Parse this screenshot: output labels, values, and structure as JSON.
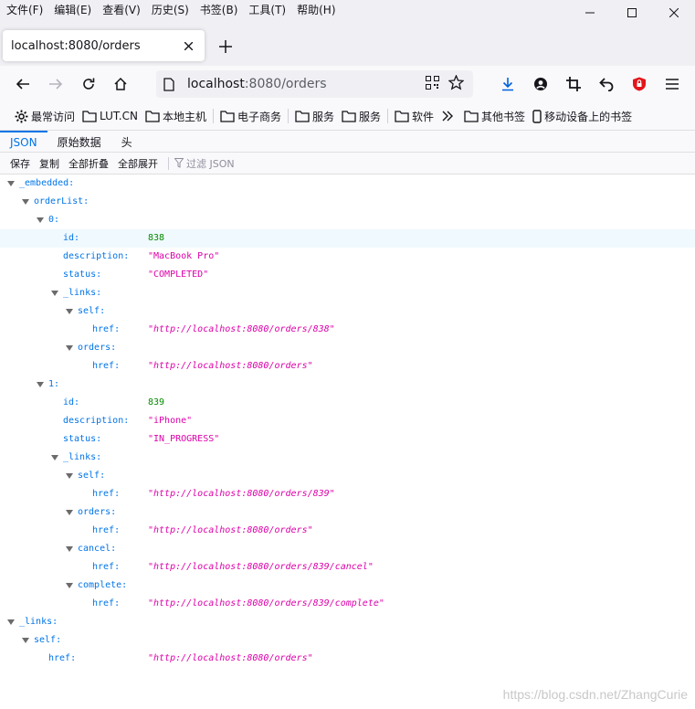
{
  "menu": [
    "文件(F)",
    "编辑(E)",
    "查看(V)",
    "历史(S)",
    "书签(B)",
    "工具(T)",
    "帮助(H)"
  ],
  "tab": {
    "title": "localhost:8080/orders"
  },
  "url": {
    "host": "localhost",
    "path": ":8080/orders"
  },
  "bookmarks": [
    {
      "label": "最常访问",
      "icon": "gear-icon"
    },
    {
      "label": "LUT.CN",
      "icon": "folder-icon"
    },
    {
      "label": "本地主机",
      "icon": "folder-icon"
    },
    {
      "label": "电子商务",
      "icon": "folder-icon"
    },
    {
      "label": "服务",
      "icon": "folder-icon"
    },
    {
      "label": "服务",
      "icon": "folder-icon"
    },
    {
      "label": "软件",
      "icon": "folder-icon"
    },
    {
      "label": "其他书签",
      "icon": "folder-icon"
    },
    {
      "label": "移动设备上的书签",
      "icon": "mobile-icon"
    }
  ],
  "jsonviewer": {
    "tabs": [
      "JSON",
      "原始数据",
      "头"
    ],
    "toolbar": {
      "save": "保存",
      "copy": "复制",
      "collapse_all": "全部折叠",
      "expand_all": "全部展开",
      "filter_placeholder": "过滤 JSON"
    }
  },
  "tree": [
    {
      "key": "_embedded:",
      "depth": 0,
      "expandable": true
    },
    {
      "key": "orderList:",
      "depth": 1,
      "expandable": true
    },
    {
      "key": "0:",
      "depth": 2,
      "expandable": true
    },
    {
      "key": "id:",
      "depth": 3,
      "value": "838",
      "type": "num",
      "highlight": true
    },
    {
      "key": "description:",
      "depth": 3,
      "value": "\"MacBook Pro\"",
      "type": "str"
    },
    {
      "key": "status:",
      "depth": 3,
      "value": "\"COMPLETED\"",
      "type": "str"
    },
    {
      "key": "_links:",
      "depth": 3,
      "expandable": true
    },
    {
      "key": "self:",
      "depth": 4,
      "expandable": true
    },
    {
      "key": "href:",
      "depth": 5,
      "value": "\"http://localhost:8080/orders/838\"",
      "type": "url"
    },
    {
      "key": "orders:",
      "depth": 4,
      "expandable": true
    },
    {
      "key": "href:",
      "depth": 5,
      "value": "\"http://localhost:8080/orders\"",
      "type": "url"
    },
    {
      "key": "1:",
      "depth": 2,
      "expandable": true
    },
    {
      "key": "id:",
      "depth": 3,
      "value": "839",
      "type": "num"
    },
    {
      "key": "description:",
      "depth": 3,
      "value": "\"iPhone\"",
      "type": "str"
    },
    {
      "key": "status:",
      "depth": 3,
      "value": "\"IN_PROGRESS\"",
      "type": "str"
    },
    {
      "key": "_links:",
      "depth": 3,
      "expandable": true
    },
    {
      "key": "self:",
      "depth": 4,
      "expandable": true
    },
    {
      "key": "href:",
      "depth": 5,
      "value": "\"http://localhost:8080/orders/839\"",
      "type": "url"
    },
    {
      "key": "orders:",
      "depth": 4,
      "expandable": true
    },
    {
      "key": "href:",
      "depth": 5,
      "value": "\"http://localhost:8080/orders\"",
      "type": "url"
    },
    {
      "key": "cancel:",
      "depth": 4,
      "expandable": true
    },
    {
      "key": "href:",
      "depth": 5,
      "value": "\"http://localhost:8080/orders/839/cancel\"",
      "type": "url"
    },
    {
      "key": "complete:",
      "depth": 4,
      "expandable": true
    },
    {
      "key": "href:",
      "depth": 5,
      "value": "\"http://localhost:8080/orders/839/complete\"",
      "type": "url"
    },
    {
      "key": "_links:",
      "depth": 0,
      "expandable": true
    },
    {
      "key": "self:",
      "depth": 1,
      "expandable": true
    },
    {
      "key": "href:",
      "depth": 2,
      "value": "\"http://localhost:8080/orders\"",
      "type": "url"
    }
  ],
  "watermark": "https://blog.csdn.net/ZhangCurie"
}
